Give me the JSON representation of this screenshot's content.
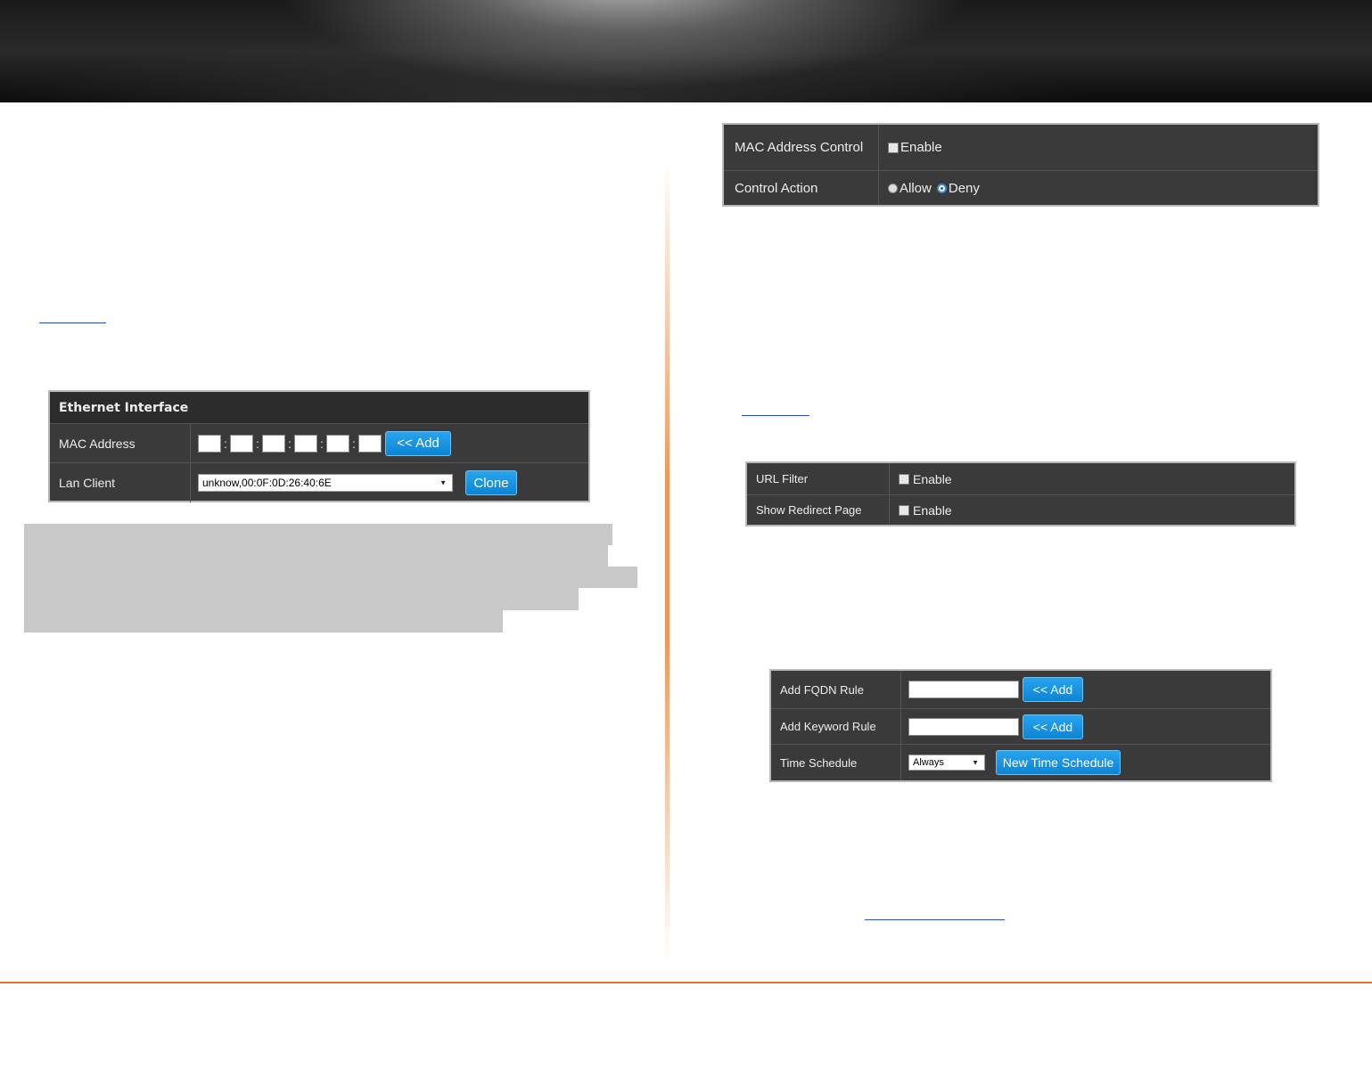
{
  "ethernet_panel": {
    "title": "Ethernet Interface",
    "mac_label": "MAC Address",
    "add_label": "<< Add",
    "lan_label": "Lan Client",
    "lan_value": "unknow,00:0F:0D:26:40:6E",
    "clone_label": "Clone"
  },
  "mac_control_panel": {
    "control_label": "MAC Address Control",
    "enable_label": "Enable",
    "action_label": "Control Action",
    "allow_label": "Allow",
    "deny_label": "Deny"
  },
  "url_filter_panel": {
    "url_label": "URL Filter",
    "url_enable": "Enable",
    "redirect_label": "Show Redirect Page",
    "redirect_enable": "Enable"
  },
  "rule_panel": {
    "fqdn_label": "Add FQDN Rule",
    "fqdn_add": "<< Add",
    "keyword_label": "Add Keyword Rule",
    "keyword_add": "<< Add",
    "schedule_label": "Time Schedule",
    "schedule_value": "Always",
    "new_schedule": "New Time Schedule"
  },
  "colors": {
    "accent_orange": "#e8722b",
    "button_blue": "#0b84d4",
    "panel_bg": "#3a3a3a"
  }
}
